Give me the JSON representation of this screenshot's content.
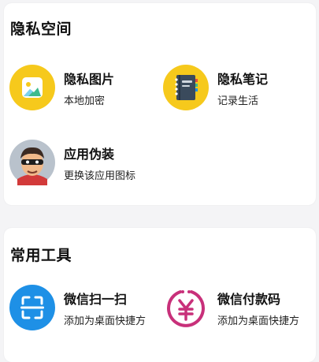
{
  "privacy": {
    "title": "隐私空间",
    "items": [
      {
        "title": "隐私图片",
        "subtitle": "本地加密",
        "icon": "gallery-icon"
      },
      {
        "title": "隐私笔记",
        "subtitle": "记录生活",
        "icon": "notebook-icon"
      },
      {
        "title": "应用伪装",
        "subtitle": "更换该应用图标",
        "icon": "masked-face-icon"
      }
    ]
  },
  "tools": {
    "title": "常用工具",
    "items": [
      {
        "title": "微信扫一扫",
        "subtitle": "添加为桌面快捷方",
        "icon": "scan-icon"
      },
      {
        "title": "微信付款码",
        "subtitle": "添加为桌面快捷方",
        "icon": "yuan-payment-icon"
      }
    ]
  },
  "colors": {
    "yellow": "#f6c91c",
    "notebook": "#3a4a5c",
    "scan_blue": "#1e90e6",
    "pay_magenta": "#c8307a"
  }
}
